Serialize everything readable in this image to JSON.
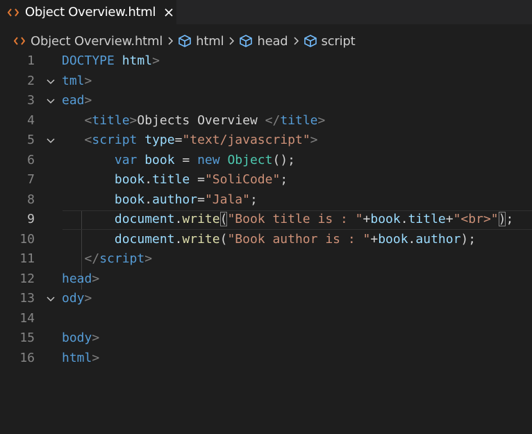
{
  "tab": {
    "title": "Object Overview.html",
    "icon": "html-file-icon",
    "icon_color": "#e37933"
  },
  "breadcrumb": {
    "file": "Object Overview.html",
    "items": [
      "html",
      "head",
      "script"
    ]
  },
  "editor": {
    "active_line": 9,
    "lines": [
      {
        "n": "1",
        "tokens": [
          [
            "t-tag",
            "DOCTYPE"
          ],
          [
            "t-txt",
            " "
          ],
          [
            "t-attr",
            "html"
          ],
          [
            "t-punct",
            ">"
          ]
        ]
      },
      {
        "n": "2",
        "fold": true,
        "tokens": [
          [
            "t-tag",
            "tml"
          ],
          [
            "t-punct",
            ">"
          ]
        ]
      },
      {
        "n": "3",
        "fold": true,
        "tokens": [
          [
            "t-tag",
            "ead"
          ],
          [
            "t-punct",
            ">"
          ]
        ]
      },
      {
        "n": "4",
        "tokens": [
          [
            "t-txt",
            "   "
          ],
          [
            "t-punct",
            "<"
          ],
          [
            "t-tag",
            "title"
          ],
          [
            "t-punct",
            ">"
          ],
          [
            "t-txt",
            "Objects Overview "
          ],
          [
            "t-punct",
            "</"
          ],
          [
            "t-tag",
            "title"
          ],
          [
            "t-punct",
            ">"
          ]
        ]
      },
      {
        "n": "5",
        "fold": true,
        "tokens": [
          [
            "t-txt",
            "   "
          ],
          [
            "t-punct",
            "<"
          ],
          [
            "t-tag",
            "script"
          ],
          [
            "t-txt",
            " "
          ],
          [
            "t-attr",
            "type"
          ],
          [
            "t-txt",
            "="
          ],
          [
            "t-str",
            "\"text/javascript\""
          ],
          [
            "t-punct",
            ">"
          ]
        ]
      },
      {
        "n": "6",
        "tokens": [
          [
            "t-txt",
            "       "
          ],
          [
            "t-kw",
            "var"
          ],
          [
            "t-txt",
            " "
          ],
          [
            "t-var",
            "book"
          ],
          [
            "t-txt",
            " = "
          ],
          [
            "t-kw",
            "new"
          ],
          [
            "t-txt",
            " "
          ],
          [
            "t-cls",
            "Object"
          ],
          [
            "t-txt",
            "();"
          ]
        ]
      },
      {
        "n": "7",
        "tokens": [
          [
            "t-txt",
            "       "
          ],
          [
            "t-var",
            "book"
          ],
          [
            "t-txt",
            "."
          ],
          [
            "t-var",
            "title"
          ],
          [
            "t-txt",
            " ="
          ],
          [
            "t-str",
            "\"SoliCode\""
          ],
          [
            "t-txt",
            ";"
          ]
        ]
      },
      {
        "n": "8",
        "tokens": [
          [
            "t-txt",
            "       "
          ],
          [
            "t-var",
            "book"
          ],
          [
            "t-txt",
            "."
          ],
          [
            "t-var",
            "author"
          ],
          [
            "t-txt",
            "="
          ],
          [
            "t-str",
            "\"Jala\""
          ],
          [
            "t-txt",
            ";"
          ]
        ]
      },
      {
        "n": "9",
        "tokens": [
          [
            "t-txt",
            "       "
          ],
          [
            "t-var",
            "document"
          ],
          [
            "t-txt",
            "."
          ],
          [
            "t-fn",
            "write"
          ],
          [
            "t-txt bm",
            "("
          ],
          [
            "t-str",
            "\"Book title is : \""
          ],
          [
            "t-txt",
            "+"
          ],
          [
            "t-var",
            "book"
          ],
          [
            "t-txt",
            "."
          ],
          [
            "t-var",
            "title"
          ],
          [
            "t-txt",
            "+"
          ],
          [
            "t-str",
            "\"<br>\""
          ],
          [
            "t-txt bm",
            ")"
          ],
          [
            "t-txt",
            ";"
          ]
        ]
      },
      {
        "n": "10",
        "tokens": [
          [
            "t-txt",
            "       "
          ],
          [
            "t-var",
            "document"
          ],
          [
            "t-txt",
            "."
          ],
          [
            "t-fn",
            "write"
          ],
          [
            "t-txt",
            "("
          ],
          [
            "t-str",
            "\"Book author is : \""
          ],
          [
            "t-txt",
            "+"
          ],
          [
            "t-var",
            "book"
          ],
          [
            "t-txt",
            "."
          ],
          [
            "t-var",
            "author"
          ],
          [
            "t-txt",
            ");"
          ]
        ]
      },
      {
        "n": "11",
        "tokens": [
          [
            "t-txt",
            "   "
          ],
          [
            "t-punct",
            "</"
          ],
          [
            "t-tag",
            "script"
          ],
          [
            "t-punct",
            ">"
          ]
        ]
      },
      {
        "n": "12",
        "tokens": [
          [
            "t-tag",
            "head"
          ],
          [
            "t-punct",
            ">"
          ]
        ]
      },
      {
        "n": "13",
        "fold": true,
        "tokens": [
          [
            "t-tag",
            "ody"
          ],
          [
            "t-punct",
            ">"
          ]
        ]
      },
      {
        "n": "14",
        "tokens": []
      },
      {
        "n": "15",
        "tokens": [
          [
            "t-tag",
            "body"
          ],
          [
            "t-punct",
            ">"
          ]
        ]
      },
      {
        "n": "16",
        "tokens": [
          [
            "t-tag",
            "html"
          ],
          [
            "t-punct",
            ">"
          ]
        ]
      }
    ]
  }
}
